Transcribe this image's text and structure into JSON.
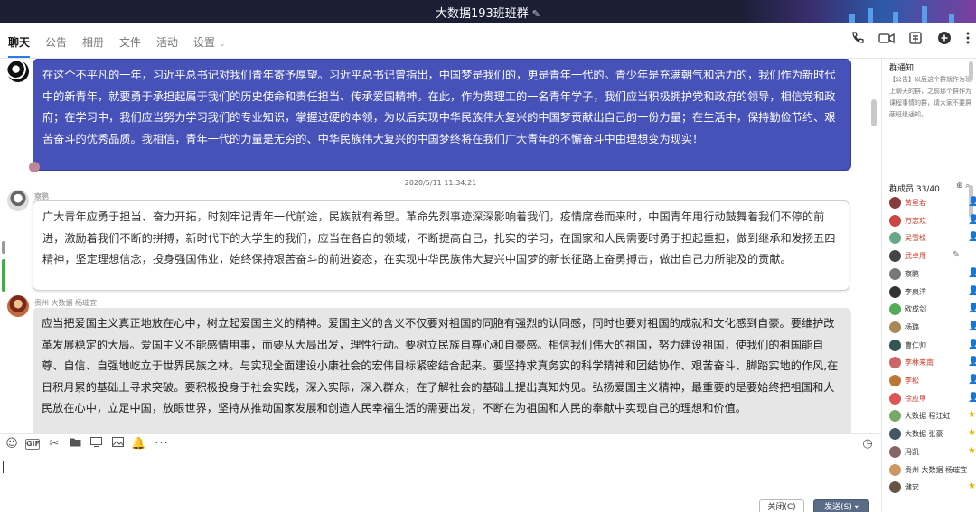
{
  "window": {
    "title": "大数据193班班群"
  },
  "tabs": [
    {
      "label": "聊天"
    },
    {
      "label": "公告"
    },
    {
      "label": "相册"
    },
    {
      "label": "文件"
    },
    {
      "label": "活动"
    },
    {
      "label": "设置"
    }
  ],
  "messages": [
    {
      "text": "在这个不平凡的一年，习近平总书记对我们青年寄予厚望。习近平总书记曾指出，中国梦是我们的，更是青年一代的。青少年是充满朝气和活力的，我们作为新时代中的新青年，就要勇于承担起属于我们的历史使命和责任担当、传承爱国精神。在此，作为贵理工的一名青年学子，我们应当积极拥护党和政府的领导，相信党和政府；在学习中，我们应当努力学习我们的专业知识，掌握过硬的本领，为以后实现中华民族伟大复兴的中国梦贡献出自己的一份力量；在生活中，保持勤俭节约、艰苦奋斗的优秀品质。我相信，青年一代的力量是无穷的、中华民族伟大复兴的中国梦终将在我们广大青年的不懈奋斗中由理想变为现实！"
    },
    {
      "timestamp": "2020/5/11 11:34:21",
      "sender": "察鹏",
      "text": "广大青年应勇于担当、奋力开拓，时刻牢记青年一代前途，民族就有希望。革命先烈事迹深深影响着我们，疫情席卷而来时，中国青年用行动鼓舞着我们不停的前进，激励着我们不断的拼搏，新时代下的大学生的我们，应当在各自的领域，不断提高自己，扎实的学习，在国家和人民需要时勇于担起重担，做到继承和发扬五四精神，坚定理想信念，投身强国伟业，始终保持艰苦奋斗的前进姿态，在实现中华民族伟大复兴中国梦的新长征路上奋勇搏击，做出自己力所能及的贡献。"
    },
    {
      "sender": "贵州  大数据  杨璀宜",
      "text": "应当把爱国主义真正地放在心中，树立起爱国主义的精神。爱国主义的含义不仅要对祖国的同胞有强烈的认同感，同时也要对祖国的成就和文化感到自豪。要维护改革发展稳定的大局。爱国主义不能感情用事，而要从大局出发，理性行动。要树立民族自尊心和自豪感。相信我们伟大的祖国，努力建设祖国，使我们的祖国能自尊、自信、自强地屹立于世界民族之林。与实现全面建设小康社会的宏伟目标紧密结合起来。要坚持求真务实的科学精神和团结协作、艰苦奋斗、脚踏实地的作风,在日积月累的基础上寻求突破。要积极投身于社会实践，深入实际，深入群众，在了解社会的基础上提出真知灼见。弘扬爱国主义精神，最重要的是要始终把祖国和人民放在心中，立足中国，放眼世界，坚持从推动国家发展和创造人民幸福生活的需要出发，不断在为祖国和人民的奉献中实现自己的理想和价值。"
    }
  ],
  "input": {
    "close_label": "关闭(C)",
    "send_label": "发送(S)"
  },
  "notice": {
    "title": "群通知",
    "text": "【公告】以后这个群就作为班上聊天的群，之前那个群作为课程事情的群，请大家不要屏蔽班级通知。"
  },
  "members": {
    "title": "群成员 33/40",
    "list": [
      {
        "name": "黄星若",
        "red": true,
        "role": "person"
      },
      {
        "name": "万志欢",
        "red": true,
        "role": "person"
      },
      {
        "name": "吴雪松",
        "red": true,
        "role": "person"
      },
      {
        "name": "武卓用",
        "red": true,
        "role": "pen"
      },
      {
        "name": "察鹏",
        "red": false,
        "role": "person"
      },
      {
        "name": "李泉洋",
        "red": false,
        "role": "person"
      },
      {
        "name": "欧成剑",
        "red": false,
        "role": "person"
      },
      {
        "name": "杨璐",
        "red": false,
        "role": "person"
      },
      {
        "name": "曹仁帅",
        "red": false,
        "role": "person"
      },
      {
        "name": "李林来南",
        "red": true,
        "role": "person"
      },
      {
        "name": "李松",
        "red": true,
        "role": "person"
      },
      {
        "name": "徐应甲",
        "red": true,
        "role": "person"
      },
      {
        "name": "大数据  程江虹",
        "red": false,
        "role": "star"
      },
      {
        "name": "大数据  张豪",
        "red": false,
        "role": "star"
      },
      {
        "name": "冯凯",
        "red": false,
        "role": "star"
      },
      {
        "name": "贵州  大数据  杨璀宜",
        "red": false,
        "role": ""
      },
      {
        "name": "健安",
        "red": false,
        "role": "star"
      }
    ]
  },
  "colors": {
    "accent": "#2b7bea",
    "self_bubble": "#4752b8",
    "member_name_red": "#d23b2b"
  }
}
